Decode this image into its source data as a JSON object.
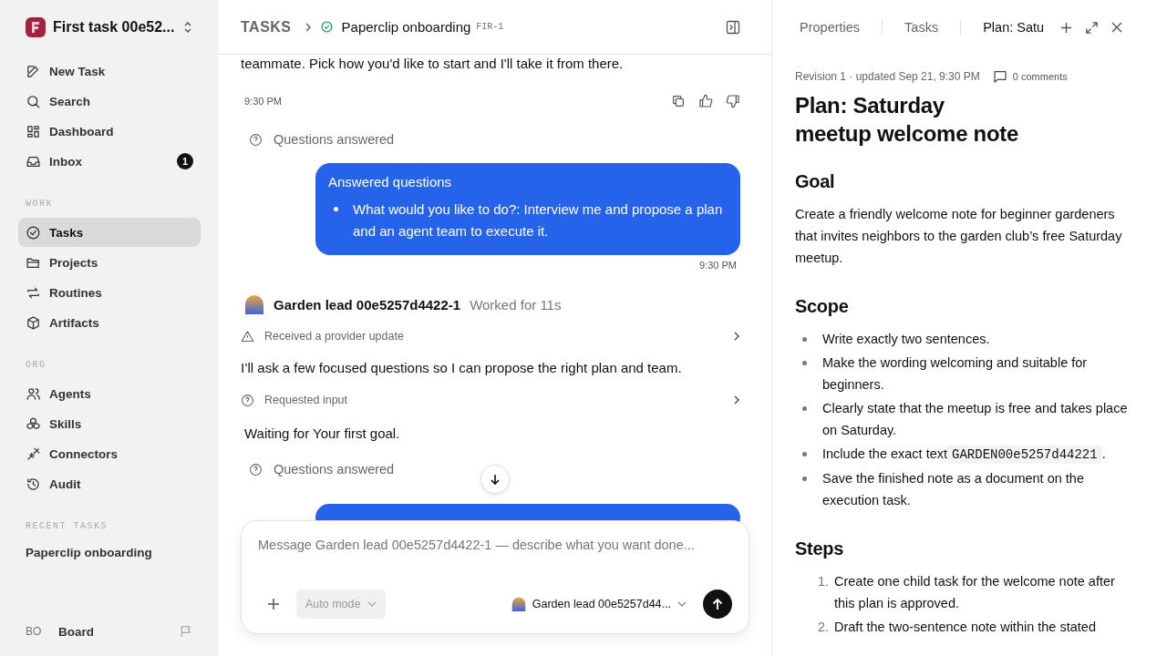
{
  "workspace": {
    "name": "First task 00e52..."
  },
  "nav": [
    {
      "label": "New Task",
      "selected": false
    },
    {
      "label": "Search",
      "selected": false
    },
    {
      "label": "Dashboard",
      "selected": false
    },
    {
      "label": "Inbox",
      "selected": false,
      "badge": "1"
    }
  ],
  "sections": [
    {
      "title": "WORK",
      "items": [
        {
          "label": "Tasks",
          "selected": true
        },
        {
          "label": "Projects",
          "selected": false
        },
        {
          "label": "Routines",
          "selected": false
        },
        {
          "label": "Artifacts",
          "selected": false
        }
      ]
    },
    {
      "title": "ORG",
      "items": [
        {
          "label": "Agents",
          "selected": false
        },
        {
          "label": "Skills",
          "selected": false
        },
        {
          "label": "Connectors",
          "selected": false
        },
        {
          "label": "Audit",
          "selected": false
        }
      ]
    }
  ],
  "recent": {
    "title": "RECENT TASKS",
    "items": [
      {
        "label": "Paperclip onboarding",
        "selected": false
      }
    ]
  },
  "user": {
    "initials": "BO",
    "name": "Board"
  },
  "breadcrumb": {
    "root": "TASKS",
    "title": "Paperclip onboarding",
    "code": "FIR-1"
  },
  "thread": [
    {
      "kind": "text",
      "text": "teammate. Pick how you'd like to start and I'll take it from there."
    },
    {
      "kind": "meta",
      "time": "9:30 PM"
    },
    {
      "kind": "status",
      "text": "Questions answered"
    },
    {
      "kind": "bubble",
      "title": "Answered questions",
      "bullets": [
        "What would you like to do?: Interview me and propose a plan and an agent team to execute it."
      ],
      "time": "9:30 PM"
    },
    {
      "kind": "agent",
      "name": "Garden lead 00e5257d4422-1",
      "note": "Worked for 11s"
    },
    {
      "kind": "notice",
      "text": "Received a provider update"
    },
    {
      "kind": "text",
      "text": "I’ll ask a few focused questions so I can propose the right plan and team."
    },
    {
      "kind": "request",
      "text": "Requested input"
    },
    {
      "kind": "text",
      "text": "Waiting for Your first goal."
    },
    {
      "kind": "status",
      "text": "Questions answered"
    },
    {
      "kind": "bubble_edge"
    }
  ],
  "composer": {
    "placeholder": "Message Garden lead 00e5257d4422-1 — describe what you want done...",
    "mode": "Auto mode",
    "agent": "Garden lead 00e5257d44..."
  },
  "panel": {
    "tabs": [
      {
        "label": "Properties",
        "selected": false
      },
      {
        "label": "Tasks",
        "selected": false
      },
      {
        "label": "Plan: Satu",
        "selected": true
      }
    ],
    "meta": "Revision 1 · updated Sep 21, 9:30 PM",
    "comments": "0 comments",
    "title": "Plan: Saturday meetup welcome note",
    "blocks": [
      {
        "kind": "heading",
        "text": "Goal"
      },
      {
        "kind": "paragraph",
        "text": "Create a friendly welcome note for beginner gardeners that invites neighbors to the garden club’s free Saturday meetup."
      },
      {
        "kind": "heading",
        "text": "Scope"
      },
      {
        "kind": "bullets",
        "items": [
          {
            "text": "Write exactly two sentences."
          },
          {
            "text": "Make the wording welcoming and suitable for beginners."
          },
          {
            "text": "Clearly state that the meetup is free and takes place on Saturday."
          },
          {
            "text": "Include the exact text",
            "code": "GARDEN00e5257d44221",
            "after": "."
          },
          {
            "text": "Save the finished note as a document on the execution task."
          }
        ]
      },
      {
        "kind": "heading",
        "text": "Steps"
      },
      {
        "kind": "steps",
        "items": [
          {
            "number": "1.",
            "text": "Create one child task for the welcome note after this plan is approved."
          },
          {
            "number": "2.",
            "text": "Draft the two-sentence note within the stated"
          }
        ]
      }
    ]
  }
}
